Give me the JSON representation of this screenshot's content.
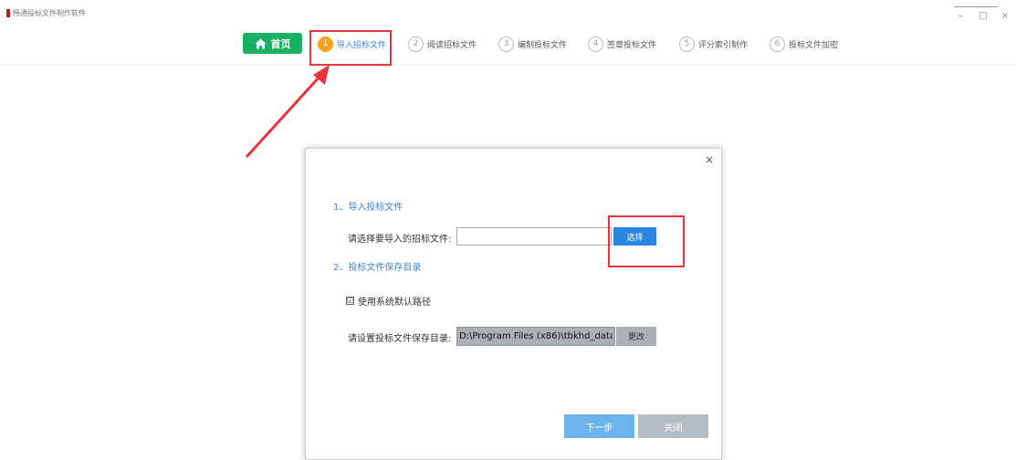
{
  "app": {
    "title": "畅通投标文件制作软件",
    "window_controls": {
      "minimize": "–",
      "restore": "□",
      "close": "×"
    }
  },
  "steps": {
    "home_label": "首页",
    "items": [
      {
        "num": "1",
        "label": "导入招标文件",
        "active": true
      },
      {
        "num": "2",
        "label": "阅读招标文件",
        "active": false
      },
      {
        "num": "3",
        "label": "编制投标文件",
        "active": false
      },
      {
        "num": "4",
        "label": "签章投标文件",
        "active": false
      },
      {
        "num": "5",
        "label": "评分索引制作",
        "active": false
      },
      {
        "num": "6",
        "label": "投标文件加密",
        "active": false
      }
    ]
  },
  "dialog": {
    "close": "×",
    "section1_title": "1、导入投标文件",
    "file_label": "请选择要导入的招标文件:",
    "file_value": "",
    "select_button": "选择",
    "section2_title": "2、投标文件保存目录",
    "checkbox_mark": "☑",
    "checkbox_label": "使用系统默认路径",
    "checkbox_checked": true,
    "dir_label": "请设置投标文件保存目录:",
    "dir_value": "D:\\Program Files (x86)\\tbkhd_data\\",
    "change_button": "更改",
    "next_button": "下一步",
    "close_button": "关闭"
  },
  "colors": {
    "home_green": "#19b063",
    "active_step_orange": "#f7a21b",
    "accent_blue": "#2a86e0",
    "annotation_red": "#e8343a"
  }
}
